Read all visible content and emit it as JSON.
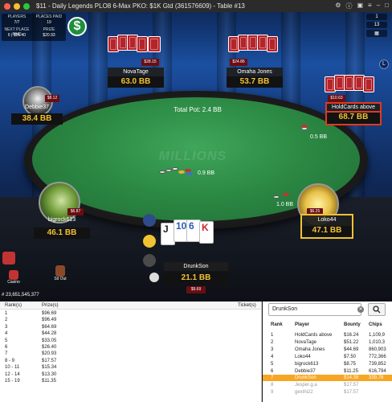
{
  "titlebar": {
    "title": "$11 - Daily Legends PLO8 6-Max PKO: $1K Gtd  (361576609) - Table #13"
  },
  "hud": {
    "players_label": "PLAYERS",
    "players_value": "7/7",
    "places_paid_label": "PLACES PAID",
    "places_paid_value": "19",
    "next_place_label": "NEXT PLACE PAID",
    "next_place_value": "6 | $26.40",
    "prize_label": "PRIZE",
    "prize_value": "$20.93"
  },
  "top_right": {
    "r1": "1",
    "r2": "13",
    "badge": "L"
  },
  "pot": {
    "label": "Total Pot: 2.4 BB"
  },
  "felt_logo": "MILLIONS",
  "seats": {
    "novatage": {
      "name": "NovaTage",
      "stack": "63.0 BB",
      "bounty": "$28.15"
    },
    "omaha_jones": {
      "name": "Omaha Jones",
      "stack": "53.7 BB",
      "bounty": "$24.86"
    },
    "holdcards": {
      "name": "HoldCards above",
      "stack": "68.7 BB",
      "bounty": "$10.63"
    },
    "debbie37": {
      "name": "Debbie37",
      "stack": "38.4 BB",
      "bounty": "$8.12"
    },
    "bigrock613": {
      "name": "bigrock613",
      "stack": "46.1 BB",
      "bounty": "$6.87"
    },
    "loko44": {
      "name": "Loko44",
      "stack": "47.1 BB",
      "bounty": "$6.25"
    },
    "drunkson": {
      "name": "DrunkSon",
      "stack": "21.1 BB",
      "bounty": "$9.69"
    }
  },
  "bets": {
    "right_top": "0.5 BB",
    "center": "0.9 BB",
    "right_low": "1.0 BB"
  },
  "hero_cards": [
    "J",
    "10",
    "6",
    "K"
  ],
  "tools": {
    "casino": "Casino",
    "sitout": "Sit Out"
  },
  "balance": "# 23,651,545,377",
  "prizes": {
    "headers": {
      "rank": "Rank(s)",
      "prize": "Prize(s)",
      "ticket": "Ticket(s)"
    },
    "rows": [
      [
        "1",
        "$96.69"
      ],
      [
        "2",
        "$96.49"
      ],
      [
        "3",
        "$64.69"
      ],
      [
        "4",
        "$44.28"
      ],
      [
        "5",
        "$33.05"
      ],
      [
        "6",
        "$26.40"
      ],
      [
        "7",
        "$20.93"
      ],
      [
        "8 - 9",
        "$17.57"
      ],
      [
        "10 - 11",
        "$15.34"
      ],
      [
        "12 - 14",
        "$13.30"
      ],
      [
        "15 - 19",
        "$11.35"
      ]
    ]
  },
  "rankings": {
    "search_value": "DrunkSon",
    "headers": {
      "rank": "Rank",
      "player": "Player",
      "bounty": "Bounty",
      "chips": "Chips"
    },
    "rows": [
      [
        "1",
        "HoldCards above",
        "$16.24",
        "1,109,9"
      ],
      [
        "2",
        "NovaTage",
        "$51.22",
        "1,010,3"
      ],
      [
        "3",
        "Omaha Jones",
        "$44.69",
        "860,903"
      ],
      [
        "4",
        "Loko44",
        "$7.50",
        "772,366"
      ],
      [
        "5",
        "bigrock613",
        "$8.75",
        "739,852"
      ],
      [
        "6",
        "Debbie37",
        "$11.25",
        "616,794"
      ],
      [
        "7",
        "DrunkSon",
        "$14.38",
        "339,78"
      ],
      [
        "8",
        "Jesper.g.a",
        "",
        "$17.57"
      ],
      [
        "9",
        "gexthi22",
        "",
        "$17.57"
      ]
    ]
  }
}
